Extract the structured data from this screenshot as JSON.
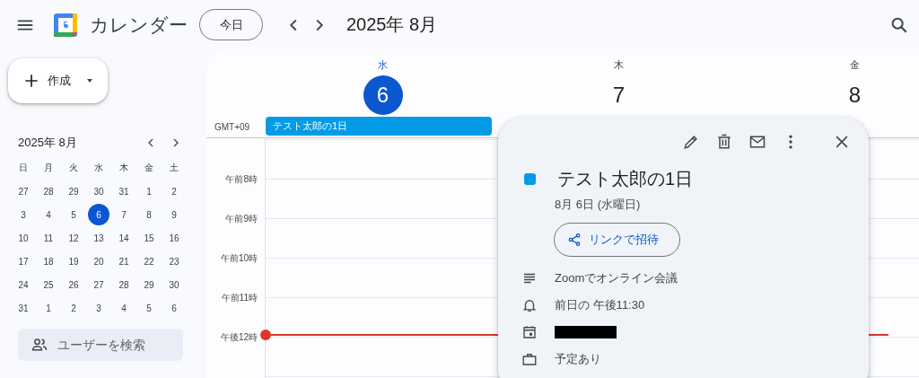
{
  "header": {
    "app_title": "カレンダー",
    "today_button": "今日",
    "period": "2025年 8月"
  },
  "create_button": "作成",
  "mini_calendar": {
    "title": "2025年 8月",
    "weekdays": [
      "日",
      "月",
      "火",
      "水",
      "木",
      "金",
      "土"
    ],
    "weeks": [
      [
        {
          "label": "27",
          "selected": false
        },
        {
          "label": "28",
          "selected": false
        },
        {
          "label": "29",
          "selected": false
        },
        {
          "label": "30",
          "selected": false
        },
        {
          "label": "31",
          "selected": false
        },
        {
          "label": "1",
          "selected": false
        },
        {
          "label": "2",
          "selected": false
        }
      ],
      [
        {
          "label": "3",
          "selected": false
        },
        {
          "label": "4",
          "selected": false
        },
        {
          "label": "5",
          "selected": false
        },
        {
          "label": "6",
          "selected": true
        },
        {
          "label": "7",
          "selected": false
        },
        {
          "label": "8",
          "selected": false
        },
        {
          "label": "9",
          "selected": false
        }
      ],
      [
        {
          "label": "10",
          "selected": false
        },
        {
          "label": "11",
          "selected": false
        },
        {
          "label": "12",
          "selected": false
        },
        {
          "label": "13",
          "selected": false
        },
        {
          "label": "14",
          "selected": false
        },
        {
          "label": "15",
          "selected": false
        },
        {
          "label": "16",
          "selected": false
        }
      ],
      [
        {
          "label": "17",
          "selected": false
        },
        {
          "label": "18",
          "selected": false
        },
        {
          "label": "19",
          "selected": false
        },
        {
          "label": "20",
          "selected": false
        },
        {
          "label": "21",
          "selected": false
        },
        {
          "label": "22",
          "selected": false
        },
        {
          "label": "23",
          "selected": false
        }
      ],
      [
        {
          "label": "24",
          "selected": false
        },
        {
          "label": "25",
          "selected": false
        },
        {
          "label": "26",
          "selected": false
        },
        {
          "label": "27",
          "selected": false
        },
        {
          "label": "28",
          "selected": false
        },
        {
          "label": "29",
          "selected": false
        },
        {
          "label": "30",
          "selected": false
        }
      ],
      [
        {
          "label": "31",
          "selected": false
        },
        {
          "label": "1",
          "selected": false
        },
        {
          "label": "2",
          "selected": false
        },
        {
          "label": "3",
          "selected": false
        },
        {
          "label": "4",
          "selected": false
        },
        {
          "label": "5",
          "selected": false
        },
        {
          "label": "6",
          "selected": false
        }
      ]
    ]
  },
  "people_search": {
    "placeholder": "ユーザーを検索"
  },
  "week_view": {
    "timezone": "GMT+09",
    "days": [
      {
        "weekday": "水",
        "date": "6",
        "selected": true
      },
      {
        "weekday": "木",
        "date": "7",
        "selected": false
      },
      {
        "weekday": "金",
        "date": "8",
        "selected": false
      }
    ],
    "all_day_events": [
      {
        "title": "テスト太郎の1日",
        "color": "#039be5"
      }
    ],
    "hours": [
      "午前8時",
      "午前9時",
      "午前10時",
      "午前11時",
      "午後12時"
    ]
  },
  "event_popup": {
    "title": "テスト太郎の1日",
    "color": "#039be5",
    "date": "8月 6日 (水曜日)",
    "invite_button": "リンクで招待",
    "details": [
      {
        "kind": "description",
        "text": "Zoomでオンライン会議"
      },
      {
        "kind": "reminder",
        "text": "前日の 午後11:30"
      },
      {
        "kind": "calendar"
      },
      {
        "kind": "availability",
        "text": "予定あり"
      }
    ]
  }
}
